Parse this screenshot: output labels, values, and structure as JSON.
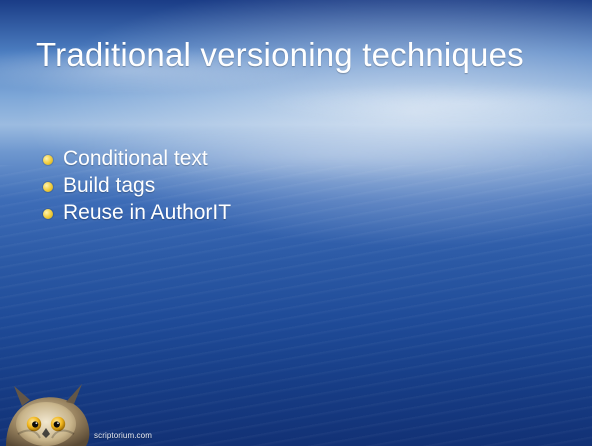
{
  "slide": {
    "title": "Traditional versioning techniques",
    "bullets": [
      "Conditional text",
      "Build tags",
      "Reuse in AuthorIT"
    ],
    "footer": "scriptorium.com"
  },
  "icons": {
    "owl": "owl-icon"
  },
  "colors": {
    "bullet": "#f4d24a",
    "text": "#ffffff"
  }
}
